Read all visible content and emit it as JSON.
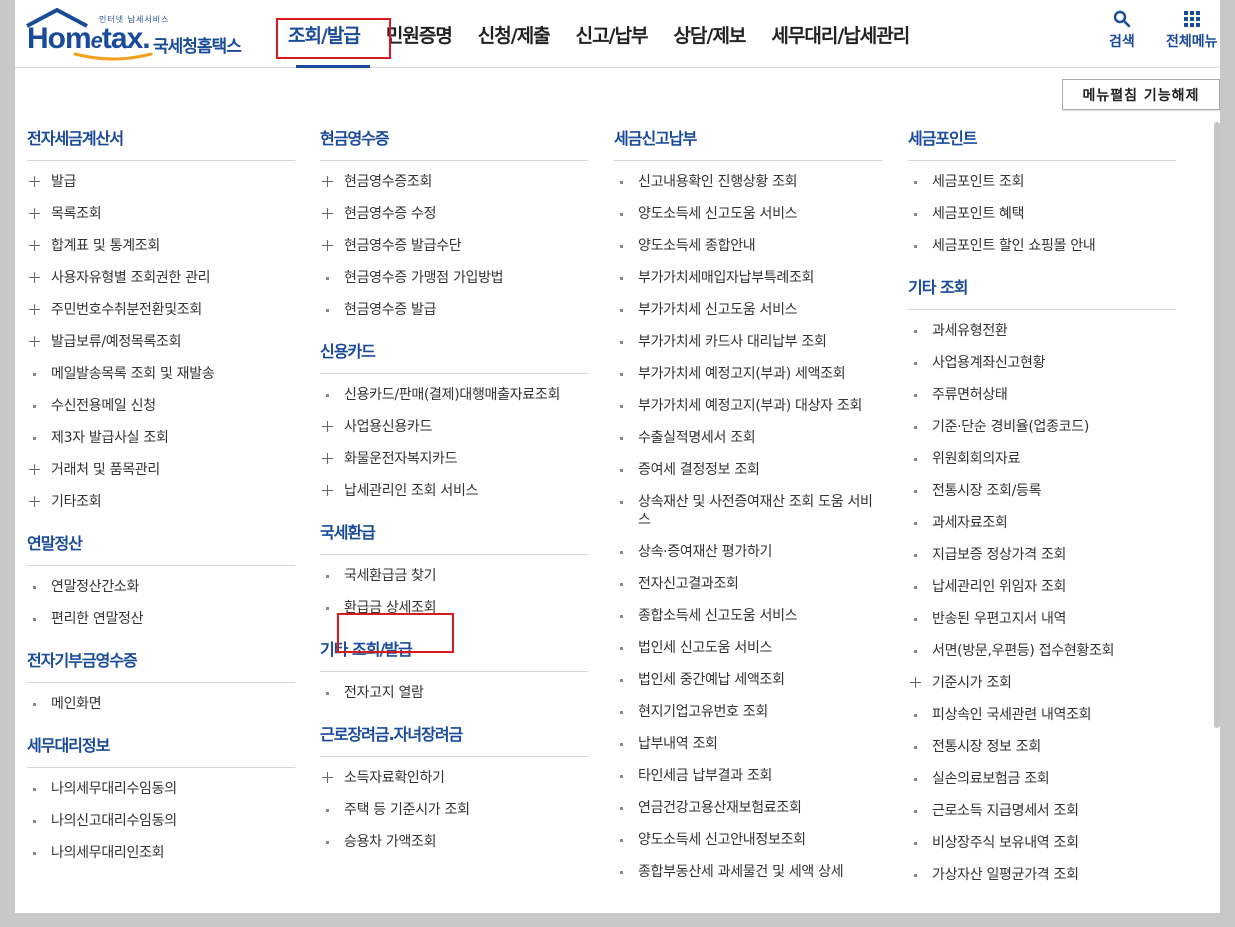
{
  "logo": {
    "tagline": "인터넷 납세서비스",
    "brand_prefix": "Hom",
    "brand_e": "e",
    "brand_suffix": "tax.",
    "korean": "국세청홈택스"
  },
  "nav": [
    {
      "label": "조회/발급",
      "active": true
    },
    {
      "label": "민원증명"
    },
    {
      "label": "신청/제출"
    },
    {
      "label": "신고/납부"
    },
    {
      "label": "상담/제보"
    },
    {
      "label": "세무대리/납세관리"
    }
  ],
  "tools": {
    "search": "검색",
    "all_menu": "전체메뉴"
  },
  "menu_off_button": "메뉴펼침 기능해제",
  "colors": {
    "accent": "#1a4b9b",
    "highlight_box": "#d9191d"
  },
  "columns": [
    [
      {
        "title": "전자세금계산서",
        "items": [
          {
            "label": "발급",
            "icon": "plus"
          },
          {
            "label": "목록조회",
            "icon": "plus"
          },
          {
            "label": "합계표 및 통계조회",
            "icon": "plus"
          },
          {
            "label": "사용자유형별 조회권한 관리",
            "icon": "plus"
          },
          {
            "label": "주민번호수취분전환및조회",
            "icon": "plus"
          },
          {
            "label": "발급보류/예정목록조회",
            "icon": "plus"
          },
          {
            "label": "메일발송목록 조회 및 재발송",
            "icon": "dot"
          },
          {
            "label": "수신전용메일 신청",
            "icon": "dot"
          },
          {
            "label": "제3자 발급사실 조회",
            "icon": "dot"
          },
          {
            "label": "거래처 및 품목관리",
            "icon": "plus"
          },
          {
            "label": "기타조회",
            "icon": "plus"
          }
        ]
      },
      {
        "title": "연말정산",
        "items": [
          {
            "label": "연말정산간소화",
            "icon": "dot"
          },
          {
            "label": "편리한 연말정산",
            "icon": "dot"
          }
        ]
      },
      {
        "title": "전자기부금영수증",
        "items": [
          {
            "label": "메인화면",
            "icon": "dot"
          }
        ]
      },
      {
        "title": "세무대리정보",
        "items": [
          {
            "label": "나의세무대리수임동의",
            "icon": "dot"
          },
          {
            "label": "나의신고대리수임동의",
            "icon": "dot"
          },
          {
            "label": "나의세무대리인조회",
            "icon": "dot"
          }
        ]
      }
    ],
    [
      {
        "title": "현금영수증",
        "items": [
          {
            "label": "현금영수증조회",
            "icon": "plus"
          },
          {
            "label": "현금영수증 수정",
            "icon": "plus"
          },
          {
            "label": "현금영수증 발급수단",
            "icon": "plus"
          },
          {
            "label": "현금영수증 가맹점 가입방법",
            "icon": "dot"
          },
          {
            "label": "현금영수증 발급",
            "icon": "dot"
          }
        ]
      },
      {
        "title": "신용카드",
        "items": [
          {
            "label": "신용카드/판매(결제)대행매출자료조회",
            "icon": "dot"
          },
          {
            "label": "사업용신용카드",
            "icon": "plus"
          },
          {
            "label": "화물운전자복지카드",
            "icon": "plus"
          },
          {
            "label": "납세관리인 조회 서비스",
            "icon": "plus"
          }
        ]
      },
      {
        "title": "국세환급",
        "items": [
          {
            "label": "국세환급금 찾기",
            "icon": "dot"
          },
          {
            "label": "환급금 상세조회",
            "icon": "dot",
            "highlighted": true
          }
        ]
      },
      {
        "title": "기타 조회/발급",
        "items": [
          {
            "label": "전자고지 열람",
            "icon": "dot"
          }
        ]
      },
      {
        "title": "근로장려금.자녀장려금",
        "items": [
          {
            "label": "소득자료확인하기",
            "icon": "plus"
          },
          {
            "label": "주택 등 기준시가 조회",
            "icon": "dot"
          },
          {
            "label": "승용차 가액조회",
            "icon": "dot"
          }
        ]
      }
    ],
    [
      {
        "title": "세금신고납부",
        "items": [
          {
            "label": "신고내용확인 진행상황 조회",
            "icon": "dot"
          },
          {
            "label": "양도소득세 신고도움 서비스",
            "icon": "dot"
          },
          {
            "label": "양도소득세 종합안내",
            "icon": "dot"
          },
          {
            "label": "부가가치세매입자납부특례조회",
            "icon": "dot"
          },
          {
            "label": "부가가치세 신고도움 서비스",
            "icon": "dot"
          },
          {
            "label": "부가가치세 카드사 대리납부 조회",
            "icon": "dot"
          },
          {
            "label": "부가가치세 예정고지(부과) 세액조회",
            "icon": "dot"
          },
          {
            "label": "부가가치세 예정고지(부과) 대상자 조회",
            "icon": "dot"
          },
          {
            "label": "수출실적명세서 조회",
            "icon": "dot"
          },
          {
            "label": "증여세 결정정보 조회",
            "icon": "dot"
          },
          {
            "label": "상속재산 및 사전증여재산 조회 도움 서비스",
            "icon": "dot"
          },
          {
            "label": "상속·증여재산 평가하기",
            "icon": "dot"
          },
          {
            "label": "전자신고결과조회",
            "icon": "dot"
          },
          {
            "label": "종합소득세 신고도움 서비스",
            "icon": "dot"
          },
          {
            "label": "법인세 신고도움 서비스",
            "icon": "dot"
          },
          {
            "label": "법인세 중간예납 세액조회",
            "icon": "dot"
          },
          {
            "label": "현지기업고유번호 조회",
            "icon": "dot"
          },
          {
            "label": "납부내역 조회",
            "icon": "dot"
          },
          {
            "label": "타인세금 납부결과 조회",
            "icon": "dot"
          },
          {
            "label": "연금건강고용산재보험료조회",
            "icon": "dot"
          },
          {
            "label": "양도소득세 신고안내정보조회",
            "icon": "dot"
          },
          {
            "label": "종합부동산세 과세물건 및 세액 상세",
            "icon": "dot"
          }
        ]
      }
    ],
    [
      {
        "title": "세금포인트",
        "items": [
          {
            "label": "세금포인트 조회",
            "icon": "dot"
          },
          {
            "label": "세금포인트 혜택",
            "icon": "dot"
          },
          {
            "label": "세금포인트 할인 쇼핑몰 안내",
            "icon": "dot"
          }
        ]
      },
      {
        "title": "기타 조회",
        "items": [
          {
            "label": "과세유형전환",
            "icon": "dot"
          },
          {
            "label": "사업용계좌신고현황",
            "icon": "dot"
          },
          {
            "label": "주류면허상태",
            "icon": "dot"
          },
          {
            "label": "기준·단순 경비율(업종코드)",
            "icon": "dot"
          },
          {
            "label": "위원회회의자료",
            "icon": "dot"
          },
          {
            "label": "전통시장 조회/등록",
            "icon": "dot"
          },
          {
            "label": "과세자료조회",
            "icon": "dot"
          },
          {
            "label": "지급보증 정상가격 조회",
            "icon": "dot"
          },
          {
            "label": "납세관리인 위임자 조회",
            "icon": "dot"
          },
          {
            "label": "반송된 우편고지서 내역",
            "icon": "dot"
          },
          {
            "label": "서면(방문,우편등) 접수현황조회",
            "icon": "dot"
          },
          {
            "label": "기준시가 조회",
            "icon": "plus"
          },
          {
            "label": "피상속인 국세관련 내역조회",
            "icon": "dot"
          },
          {
            "label": "전통시장 정보 조회",
            "icon": "dot"
          },
          {
            "label": "실손의료보험금 조회",
            "icon": "dot"
          },
          {
            "label": "근로소득 지급명세서 조회",
            "icon": "dot"
          },
          {
            "label": "비상장주식 보유내역 조회",
            "icon": "dot"
          },
          {
            "label": "가상자산 일평균가격 조회",
            "icon": "dot"
          }
        ]
      }
    ]
  ]
}
